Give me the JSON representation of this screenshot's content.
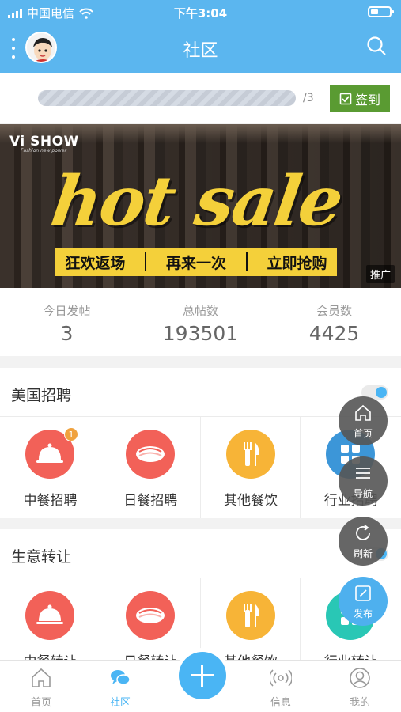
{
  "status": {
    "carrier": "中国电信",
    "time": "下午3:04"
  },
  "header": {
    "title": "社区"
  },
  "signin": {
    "progress_text": "/3",
    "button_label": "签到"
  },
  "banner": {
    "brand": "Vi SHOW",
    "brand_sub": "Fashion new power",
    "headline": "hot sale",
    "strip": [
      "狂欢返场",
      "再来一次",
      "立即抢购"
    ],
    "tag": "推广"
  },
  "stats": [
    {
      "label": "今日发帖",
      "value": "3"
    },
    {
      "label": "总帖数",
      "value": "193501"
    },
    {
      "label": "会员数",
      "value": "4425"
    }
  ],
  "sections": [
    {
      "title": "美国招聘",
      "items": [
        {
          "label": "中餐招聘",
          "icon": "cloche-icon",
          "color": "#f26158",
          "badge": "1"
        },
        {
          "label": "日餐招聘",
          "icon": "sushi-icon",
          "color": "#f26158"
        },
        {
          "label": "其他餐饮",
          "icon": "fork-knife-icon",
          "color": "#f7b437"
        },
        {
          "label": "行业招聘",
          "icon": "industry-icon",
          "color": "#3c96d8"
        }
      ]
    },
    {
      "title": "生意转让",
      "items": [
        {
          "label": "中餐转让",
          "icon": "cloche-icon",
          "color": "#f26158"
        },
        {
          "label": "日餐转让",
          "icon": "sushi-icon",
          "color": "#f26158"
        },
        {
          "label": "其他餐饮",
          "icon": "fork-knife-icon",
          "color": "#f7b437"
        },
        {
          "label": "行业转让",
          "icon": "industry-icon",
          "color": "#29c7b5"
        }
      ]
    }
  ],
  "fabs": [
    {
      "label": "首页",
      "icon": "home-icon"
    },
    {
      "label": "导航",
      "icon": "menu-icon"
    },
    {
      "label": "刷新",
      "icon": "refresh-icon"
    },
    {
      "label": "发布",
      "icon": "edit-icon"
    }
  ],
  "tabbar": [
    {
      "label": "首页",
      "icon": "home-icon"
    },
    {
      "label": "社区",
      "icon": "chat-icon",
      "active": true
    },
    {
      "label": "信息",
      "icon": "signal-icon"
    },
    {
      "label": "我的",
      "icon": "user-icon"
    }
  ],
  "colors": {
    "primary": "#5bb6ef",
    "signin_green": "#5a9b32",
    "accent": "#4ab5f4"
  }
}
